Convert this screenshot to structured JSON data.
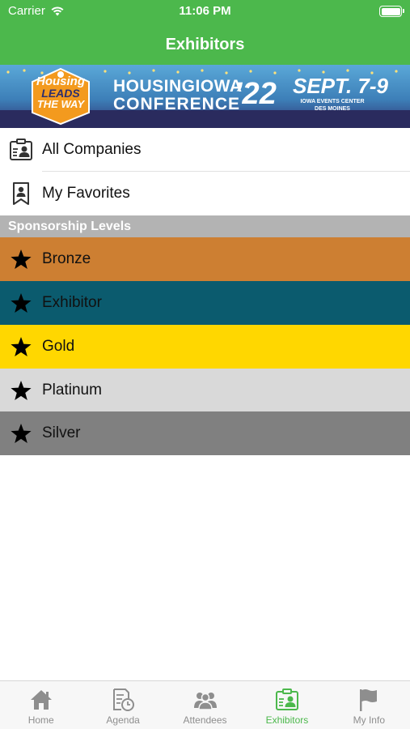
{
  "status_bar": {
    "carrier": "Carrier",
    "time": "11:06 PM"
  },
  "nav": {
    "title": "Exhibitors"
  },
  "banner": {
    "badge_line1": "Housing",
    "badge_line2": "LEADS",
    "badge_line3": "THE WAY",
    "conference_line1": "HOUSINGIOWA",
    "conference_line2": "CONFERENCE",
    "year": "’22",
    "date": "SEPT. 7-9",
    "venue_line1": "IOWA EVENTS CENTER",
    "venue_line2": "DES MOINES"
  },
  "menu": {
    "all_companies": "All Companies",
    "my_favorites": "My Favorites"
  },
  "section": {
    "title": "Sponsorship Levels"
  },
  "levels": [
    {
      "label": "Bronze",
      "color": "#cd7f32"
    },
    {
      "label": "Exhibitor",
      "color": "#0b5b6e"
    },
    {
      "label": "Gold",
      "color": "#ffd700"
    },
    {
      "label": "Platinum",
      "color": "#d9d9d9"
    },
    {
      "label": "Silver",
      "color": "#808080"
    }
  ],
  "tabs": [
    {
      "label": "Home",
      "icon": "home-icon",
      "active": false
    },
    {
      "label": "Agenda",
      "icon": "agenda-icon",
      "active": false
    },
    {
      "label": "Attendees",
      "icon": "attendees-icon",
      "active": false
    },
    {
      "label": "Exhibitors",
      "icon": "exhibitors-icon",
      "active": true
    },
    {
      "label": "My Info",
      "icon": "flag-icon",
      "active": false
    }
  ],
  "colors": {
    "accent": "#4cb84c",
    "inactive_tab": "#8e8e8e"
  }
}
